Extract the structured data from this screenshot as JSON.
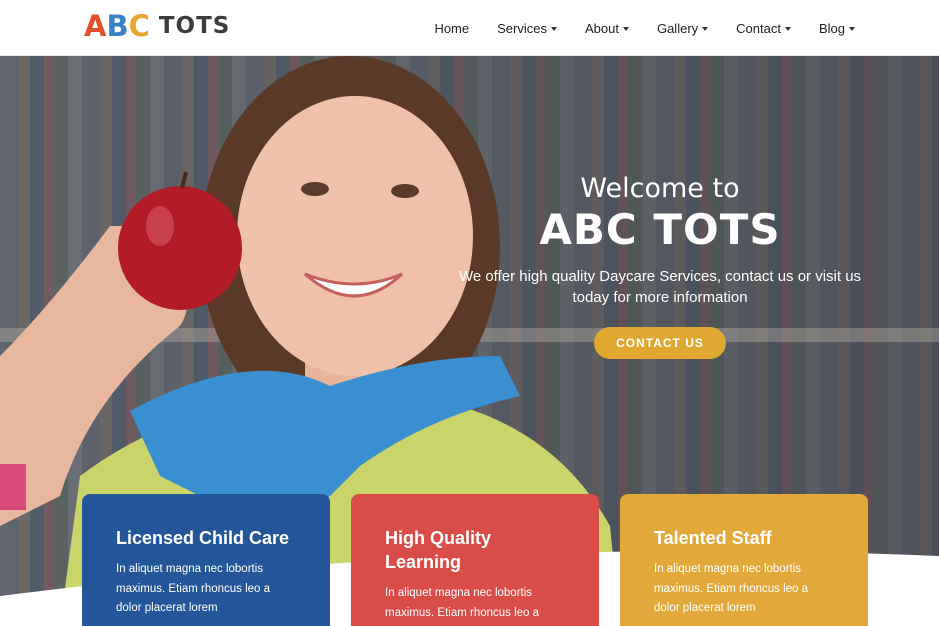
{
  "brand": {
    "letters": [
      {
        "char": "A",
        "color": "#e0502f"
      },
      {
        "char": "B",
        "color": "#3b82c4"
      },
      {
        "char": "C",
        "color": "#e8a72c"
      }
    ],
    "word": "TOTS"
  },
  "nav": {
    "items": [
      {
        "label": "Home",
        "dropdown": false
      },
      {
        "label": "Services",
        "dropdown": true
      },
      {
        "label": "About",
        "dropdown": true
      },
      {
        "label": "Gallery",
        "dropdown": true
      },
      {
        "label": "Contact",
        "dropdown": true
      },
      {
        "label": "Blog",
        "dropdown": true
      }
    ]
  },
  "hero": {
    "line1": "Welcome to",
    "line2": "ABC TOTS",
    "subtitle": "We offer high quality Daycare Services, contact us or visit us today for more information",
    "cta_label": "CONTACT US"
  },
  "cards": [
    {
      "title": "Licensed Child Care",
      "body": "In aliquet magna nec lobortis maximus. Etiam rhoncus leo a dolor placerat lorem",
      "color": "#24579a"
    },
    {
      "title": "High Quality Learning",
      "body": "In aliquet magna nec lobortis maximus. Etiam rhoncus leo a dolor placerat lorem",
      "color": "#d94c48"
    },
    {
      "title": "Talented Staff",
      "body": "In aliquet magna nec lobortis maximus. Etiam rhoncus leo a dolor placerat lorem",
      "color": "#e3a83a"
    }
  ],
  "colors": {
    "accent": "#e0a831",
    "nav_text": "#222222"
  }
}
